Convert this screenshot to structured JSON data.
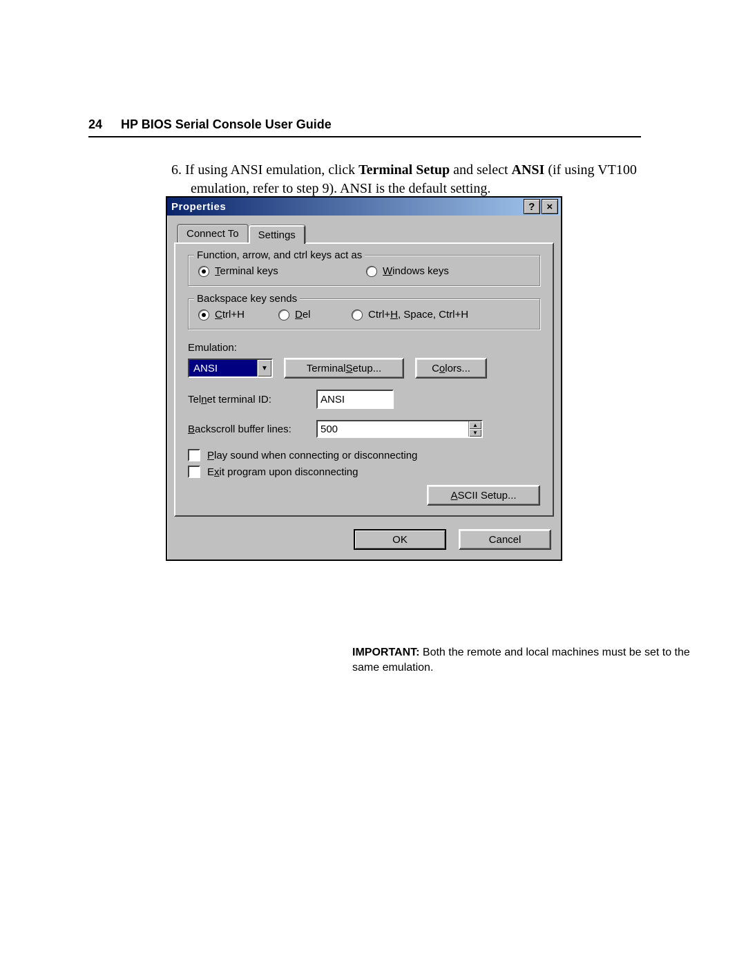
{
  "header": {
    "page_number": "24",
    "title": "HP BIOS Serial Console User Guide"
  },
  "step": {
    "number": "6.",
    "text_before": "If using ANSI emulation, click ",
    "bold1": "Terminal Setup",
    "text_mid": " and select ",
    "bold2": "ANSI",
    "text_after": " (if using VT100 emulation, refer to step 9). ANSI is the default setting."
  },
  "dialog": {
    "title": "Properties",
    "tabs": {
      "connect_to": "Connect To",
      "settings": "Settings"
    },
    "group1": {
      "label": "Function, arrow, and ctrl keys act as",
      "opt_terminal": "Terminal keys",
      "opt_windows": "Windows keys"
    },
    "group2": {
      "label": "Backspace key sends",
      "opt_ctrlh": "Ctrl+H",
      "opt_del": "Del",
      "opt_csc": "Ctrl+H, Space, Ctrl+H"
    },
    "emulation_label": "Emulation:",
    "emulation_value": "ANSI",
    "btn_terminal_setup": "Terminal Setup...",
    "btn_colors": "Colors...",
    "telnet_label": "Telnet terminal ID:",
    "telnet_value": "ANSI",
    "backscroll_label": "Backscroll buffer lines:",
    "backscroll_value": "500",
    "chk_play": "Play sound when connecting or disconnecting",
    "chk_exit": "Exit program upon disconnecting",
    "btn_ascii": "ASCII Setup...",
    "btn_ok": "OK",
    "btn_cancel": "Cancel"
  },
  "note": {
    "label": "IMPORTANT:",
    "text": "  Both the remote and local machines must be set to the same emulation."
  }
}
